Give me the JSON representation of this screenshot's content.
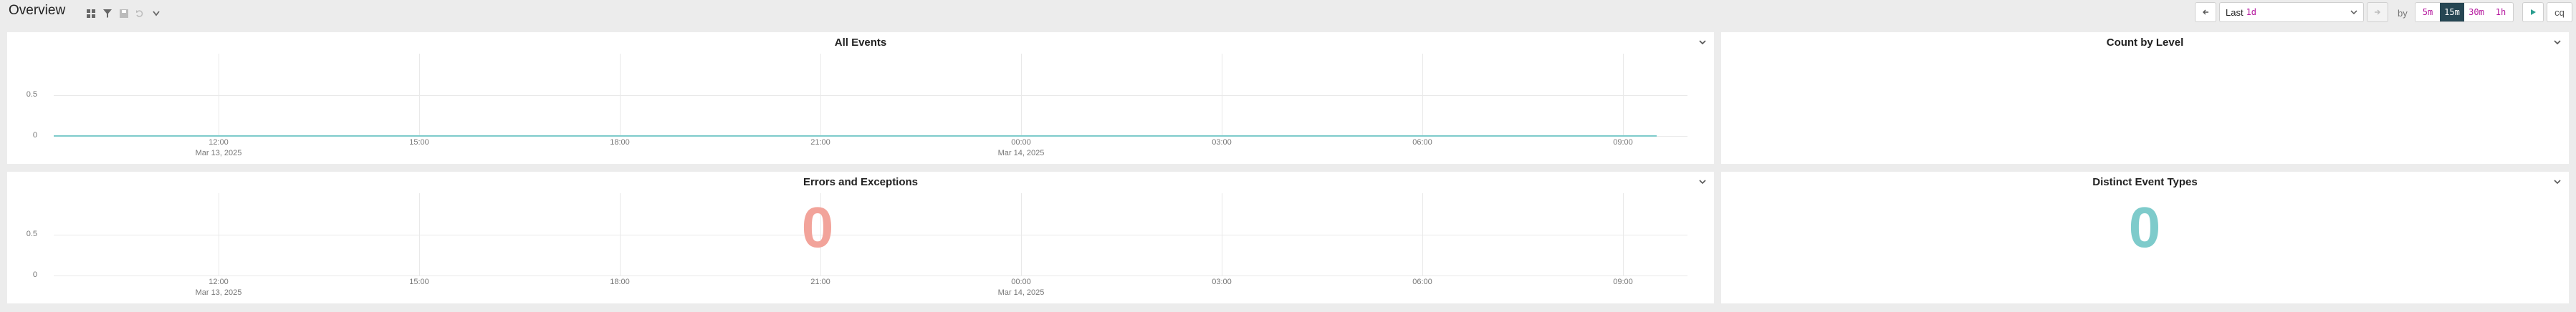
{
  "header": {
    "title": "Overview",
    "icons": [
      "grid-icon",
      "filter-icon",
      "save-icon",
      "undo-icon",
      "chevron-down-icon"
    ]
  },
  "controls": {
    "range_prefix": "Last",
    "range_value": "1d",
    "by_label": "by",
    "intervals": [
      "5m",
      "15m",
      "30m",
      "1h"
    ],
    "active_interval": "15m",
    "last_button": "cq"
  },
  "panels": {
    "all_events": {
      "title": "All Events",
      "chart_data": {
        "type": "line",
        "y_ticks": [
          "0.5",
          "0"
        ],
        "x_ticks": [
          {
            "label": "12:00",
            "sub": "Mar 13, 2025"
          },
          {
            "label": "15:00",
            "sub": ""
          },
          {
            "label": "18:00",
            "sub": ""
          },
          {
            "label": "21:00",
            "sub": ""
          },
          {
            "label": "00:00",
            "sub": "Mar 14, 2025"
          },
          {
            "label": "03:00",
            "sub": ""
          },
          {
            "label": "06:00",
            "sub": ""
          },
          {
            "label": "09:00",
            "sub": ""
          }
        ],
        "series": [
          {
            "values": [
              0,
              0
            ],
            "color": "#7ecbcb"
          }
        ],
        "ylim": [
          0,
          1
        ]
      }
    },
    "count_by_level": {
      "title": "Count by Level"
    },
    "errors": {
      "title": "Errors and Exceptions",
      "value": "0",
      "value_color": "#f2a39a",
      "chart_data": {
        "type": "line",
        "y_ticks": [
          "0.5",
          "0"
        ],
        "x_ticks": [
          {
            "label": "12:00",
            "sub": "Mar 13, 2025"
          },
          {
            "label": "15:00",
            "sub": ""
          },
          {
            "label": "18:00",
            "sub": ""
          },
          {
            "label": "21:00",
            "sub": ""
          },
          {
            "label": "00:00",
            "sub": "Mar 14, 2025"
          },
          {
            "label": "03:00",
            "sub": ""
          },
          {
            "label": "06:00",
            "sub": ""
          },
          {
            "label": "09:00",
            "sub": ""
          }
        ],
        "ylim": [
          0,
          1
        ]
      }
    },
    "distinct_types": {
      "title": "Distinct Event Types",
      "value": "0",
      "value_color": "#7ecbcb"
    }
  }
}
